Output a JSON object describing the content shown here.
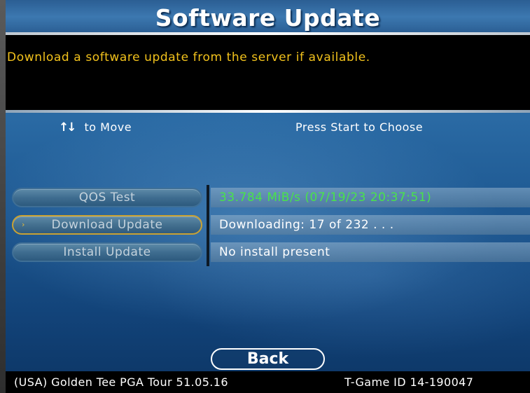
{
  "header": {
    "title": "Software Update"
  },
  "description": {
    "text": "Download a software update from the server if available."
  },
  "hints": {
    "move_icon": "↑↓",
    "move": "to Move",
    "choose": "Press Start to Choose"
  },
  "menu": {
    "items": [
      {
        "label": "QOS Test",
        "status": "33.784 MiB/s (07/19/23 20:37:51)",
        "selected": false
      },
      {
        "label": "Download Update",
        "status": "Downloading: 17 of 232  . . .",
        "selected": true
      },
      {
        "label": "Install Update",
        "status": "No install present",
        "selected": false
      }
    ],
    "selected_marker": "›"
  },
  "back": {
    "label": "Back"
  },
  "footer": {
    "game": "(USA) Golden Tee PGA Tour 51.05.16",
    "tgame": "T-Game ID 14-190047"
  },
  "colors": {
    "accent_yellow": "#f2c21c",
    "status_green": "#49e34a",
    "selected_border": "#c9a233"
  }
}
